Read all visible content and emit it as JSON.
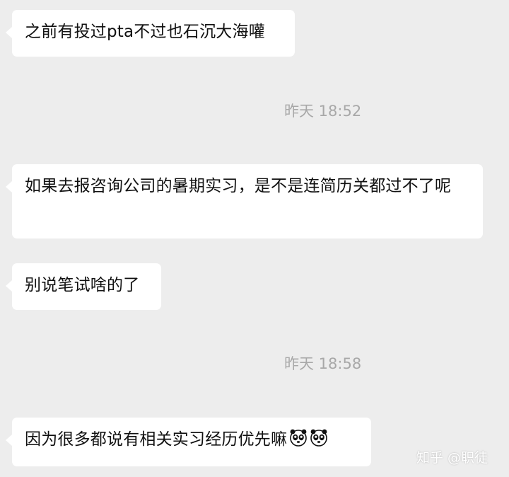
{
  "chat": {
    "messages": [
      {
        "text": "之前有投过pta不过也石沉大海嚾"
      },
      {
        "text": "如果去报咨询公司的暑期实习，是不是连简历关都过不了呢"
      },
      {
        "text": "别说笔试啥的了"
      },
      {
        "text": "因为很多都说有相关实习经历优先嘛",
        "emojis": [
          "panda-emoji",
          "panda-emoji"
        ]
      }
    ],
    "timestamps": [
      "昨天 18:52",
      "昨天 18:58"
    ]
  },
  "watermark": "知乎 @职徒",
  "colors": {
    "background": "#ededed",
    "bubble": "#ffffff",
    "timestamp": "#a8a8a8",
    "text": "#111111"
  }
}
